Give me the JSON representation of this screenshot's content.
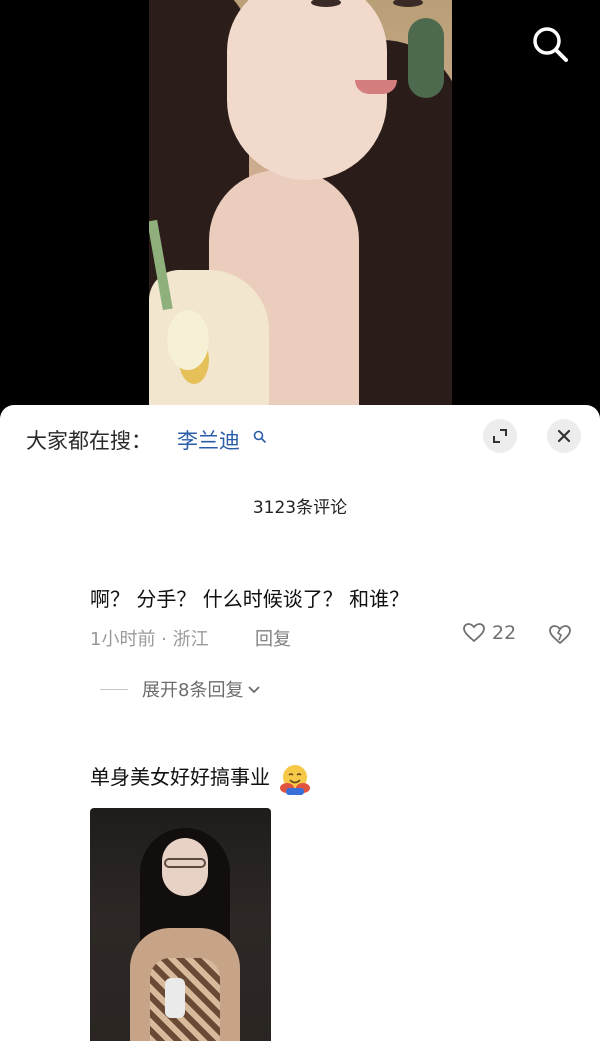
{
  "header_overlay": {
    "search_icon": "search-icon"
  },
  "comments_panel": {
    "suggest_prefix": "大家都在搜：",
    "suggest_term": "李兰迪",
    "suggest_icon": "search-small-icon",
    "expand_icon": "expand-icon",
    "close_icon": "close-icon",
    "comment_count": "3123条评论"
  },
  "comments": [
    {
      "text": "啊？ 分手？ 什么时候谈了？ 和谁？",
      "meta": "1小时前 · 浙江",
      "reply_label": "回复",
      "likes": "22",
      "expand_replies_label": "展开8条回复"
    },
    {
      "text": "单身美女好好搞事业",
      "emoji": "hugging-emoji"
    }
  ],
  "colors": {
    "link_blue": "#2a5da8",
    "meta_gray": "#9a9a9a",
    "panel_bg": "#ffffff"
  }
}
